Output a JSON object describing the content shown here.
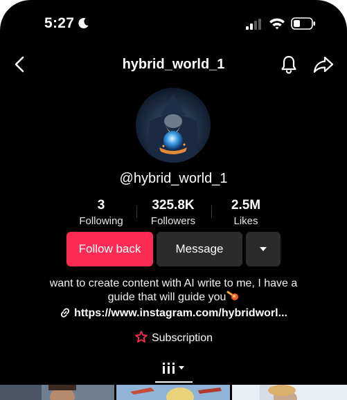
{
  "status_bar": {
    "time": "5:27",
    "icons": [
      "moon-icon",
      "signal-icon",
      "wifi-icon",
      "battery-icon"
    ]
  },
  "nav": {
    "title": "hybrid_world_1",
    "icons": [
      "back-icon",
      "bell-icon",
      "share-icon"
    ]
  },
  "profile": {
    "handle": "@hybrid_world_1",
    "stats": [
      {
        "value": "3",
        "label": "Following"
      },
      {
        "value": "325.8K",
        "label": "Followers"
      },
      {
        "value": "2.5M",
        "label": "Likes"
      }
    ],
    "buttons": {
      "follow_back": "Follow back",
      "message": "Message",
      "more_icon": "caret-down-icon"
    },
    "bio_line1": "want to create content with AI write to me, I have a",
    "bio_line2": "guide that will guide you",
    "bio_emoji": "comet",
    "link": "https://www.instagram.com/hybridworl...",
    "subscription": "Subscription"
  },
  "tabs": {
    "active": "videos-grid",
    "icons": [
      "grid-icon",
      "caret-down-icon"
    ]
  },
  "colors": {
    "background": "#000000",
    "accent": "#fe2c55",
    "secondary_button": "#2b2b2b",
    "text": "#ffffff"
  }
}
